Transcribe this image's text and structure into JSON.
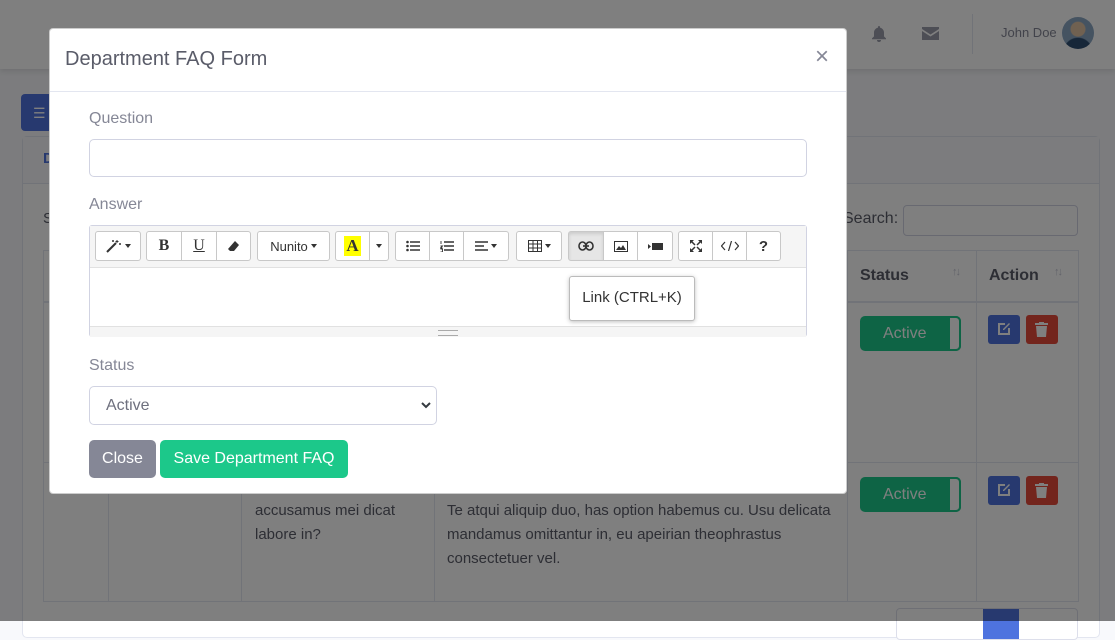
{
  "topbar": {
    "user_name": "John Doe"
  },
  "card": {
    "title_initial": "D",
    "show_initial": "S",
    "search_label": "Search:"
  },
  "table": {
    "columns": {
      "status": "Status",
      "action": "Action"
    },
    "sort_icon": "↑↓",
    "rows": [
      {
        "status": "Active",
        "question_tail": "",
        "answer_tail": ""
      },
      {
        "status": "Active",
        "question_tail": "accusamus mei dicat labore in?",
        "answer_tail": "Te atqui aliquip duo, has option habemus cu. Usu delicata mandamus omittantur in, eu apeirian theophrastus consectetuer vel."
      }
    ]
  },
  "modal": {
    "title": "Department FAQ Form",
    "close_glyph": "×",
    "question_label": "Question",
    "question_value": "",
    "answer_label": "Answer",
    "toolbar": {
      "font_name": "Nunito",
      "tooltip": "Link (CTRL+K)"
    },
    "status_label": "Status",
    "status_value": "Active",
    "close_button": "Close",
    "save_button": "Save Department FAQ"
  },
  "colors": {
    "primary": "#4e73df",
    "success": "#1cc88a",
    "danger": "#e74a3b",
    "secondary": "#858796"
  }
}
